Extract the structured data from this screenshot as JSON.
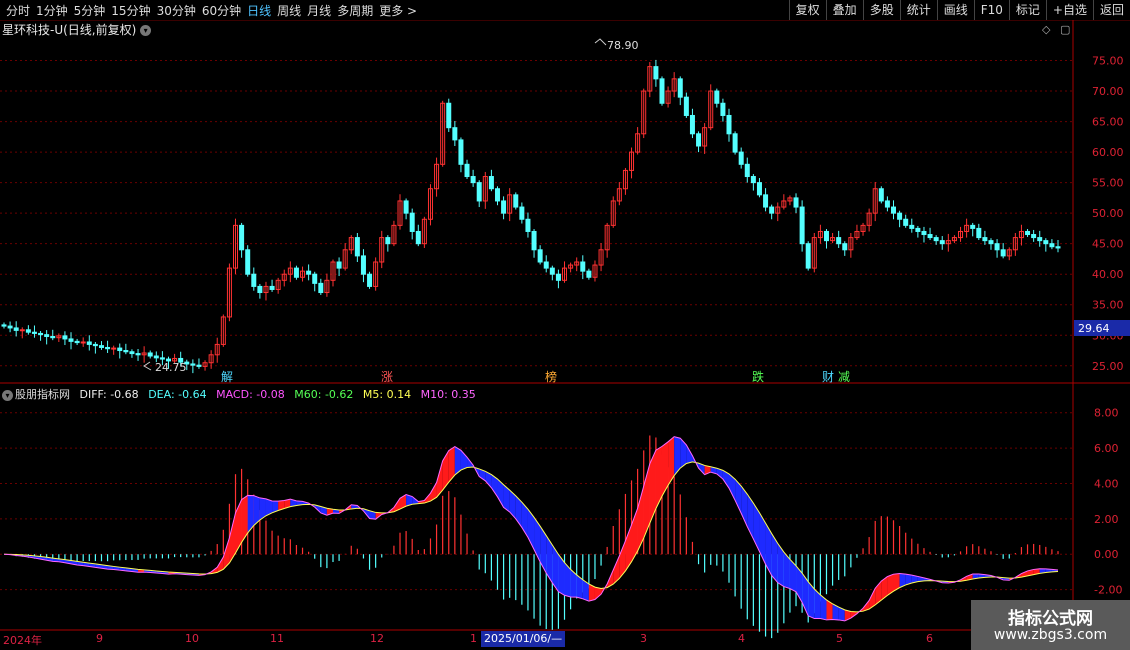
{
  "toolbar": {
    "timeframes": [
      "分时",
      "1分钟",
      "5分钟",
      "15分钟",
      "30分钟",
      "60分钟",
      "日线",
      "周线",
      "月线",
      "多周期",
      "更多 >"
    ],
    "active": "日线",
    "tools": [
      "复权",
      "叠加",
      "多股",
      "统计",
      "画线",
      "F10",
      "标记",
      "+自选",
      "返回"
    ]
  },
  "main_title": "星环科技-U(日线,前复权)",
  "price_axis": [
    "75.00",
    "70.00",
    "65.00",
    "60.00",
    "55.00",
    "50.00",
    "45.00",
    "40.00",
    "35.00",
    "30.00",
    "25.00"
  ],
  "current_price": "29.64",
  "high_label": "78.90",
  "low_label": "24.75",
  "event_labels": [
    "解",
    "涨",
    "榜",
    "跌",
    "财",
    "减"
  ],
  "indicator": {
    "name": "股朋指标网",
    "diff": "DIFF: -0.68",
    "dea": "DEA: -0.64",
    "macd": "MACD: -0.08",
    "m60": "M60: -0.62",
    "m5": "M5: 0.14",
    "m10": "M10: 0.35"
  },
  "ind_axis": [
    "8.00",
    "6.00",
    "4.00",
    "2.00",
    "0.00",
    "-2.00"
  ],
  "date_axis": [
    "2024年",
    "9",
    "10",
    "11",
    "12",
    "1",
    "3",
    "4",
    "5",
    "6"
  ],
  "date_cursor": "2025/01/06/—",
  "watermark": {
    "line1": "指标公式网",
    "line2": "www.zbgs3.com"
  },
  "colors": {
    "up": "#ff3232",
    "down": "#54ffff",
    "blue_band": "#1e2aff",
    "red_band": "#ff1a1a",
    "dea": "#ffff55",
    "diff": "#ff66ff"
  },
  "chart_data": {
    "type": "candlestick",
    "price_range": [
      23,
      80
    ],
    "close": [
      31.5,
      31.2,
      30.8,
      30.9,
      30.5,
      30.3,
      30.1,
      29.8,
      29.6,
      29.9,
      29.4,
      29.0,
      28.8,
      28.9,
      28.5,
      28.3,
      28.0,
      27.8,
      27.9,
      27.5,
      27.3,
      27.0,
      26.8,
      27.1,
      26.6,
      26.3,
      26.1,
      25.8,
      26.2,
      25.6,
      25.3,
      25.1,
      24.9,
      25.5,
      26.8,
      28.5,
      33,
      41,
      48,
      44,
      40,
      38,
      37,
      38,
      37.5,
      39,
      40,
      41,
      39.5,
      40.5,
      40,
      38.5,
      37,
      39,
      42,
      41,
      44,
      46,
      43,
      40,
      38,
      42,
      46,
      45,
      48,
      52,
      50,
      47,
      45,
      49,
      54,
      58,
      68,
      64,
      62,
      58,
      56,
      55,
      52,
      56,
      54,
      52,
      50,
      53,
      51,
      49,
      47,
      44,
      42,
      41,
      40,
      39,
      41,
      41.5,
      42,
      40.5,
      39.5,
      41.5,
      44,
      48,
      52,
      54,
      57,
      60,
      63,
      70,
      74,
      72,
      68,
      70,
      72,
      69,
      66,
      63,
      61,
      64,
      70,
      68,
      66,
      63,
      60,
      58,
      56,
      55,
      53,
      51,
      50,
      51,
      52,
      52.5,
      51,
      45,
      41,
      46,
      47,
      45.5,
      46,
      45,
      44,
      46,
      47,
      48,
      50,
      54,
      52,
      51,
      50,
      49,
      48,
      47.5,
      47,
      46.5,
      46,
      45.5,
      45,
      45.5,
      46,
      47,
      48,
      47.5,
      46,
      45.5,
      45,
      44,
      43,
      44,
      46,
      47,
      46.5,
      46,
      45.5,
      45,
      44.5,
      44.3
    ],
    "indicator_range": [
      -4,
      9
    ]
  }
}
